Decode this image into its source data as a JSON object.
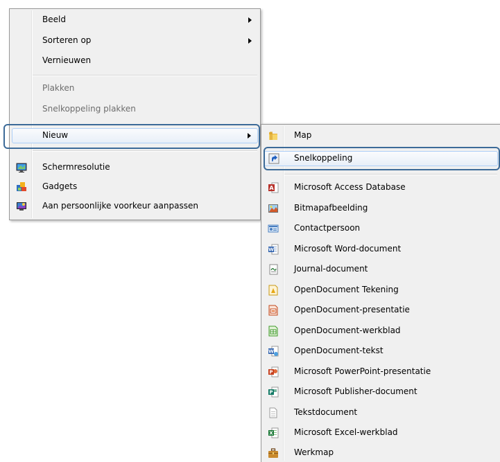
{
  "context_menu": {
    "items": [
      {
        "label": "Beeld",
        "has_submenu": true
      },
      {
        "label": "Sorteren op",
        "has_submenu": true
      },
      {
        "label": "Vernieuwen"
      },
      {
        "label": "Plakken",
        "disabled": true
      },
      {
        "label": "Snelkoppeling plakken",
        "disabled": true
      },
      {
        "label": "Nieuw",
        "has_submenu": true,
        "highlighted": true
      },
      {
        "label": "Schermresolutie",
        "icon": "monitor-icon"
      },
      {
        "label": "Gadgets",
        "icon": "gadgets-icon"
      },
      {
        "label": "Aan persoonlijke voorkeur aanpassen",
        "icon": "personalize-icon"
      }
    ]
  },
  "submenu": {
    "items": [
      {
        "label": "Map",
        "icon": "folder-icon"
      },
      {
        "label": "Snelkoppeling",
        "icon": "shortcut-icon",
        "highlighted": true
      },
      {
        "label": "Microsoft Access Database",
        "icon": "access-icon"
      },
      {
        "label": "Bitmapafbeelding",
        "icon": "bitmap-icon"
      },
      {
        "label": "Contactpersoon",
        "icon": "contact-icon"
      },
      {
        "label": "Microsoft Word-document",
        "icon": "word-icon"
      },
      {
        "label": "Journal-document",
        "icon": "journal-icon"
      },
      {
        "label": "OpenDocument Tekening",
        "icon": "odg-icon"
      },
      {
        "label": "OpenDocument-presentatie",
        "icon": "odp-icon"
      },
      {
        "label": "OpenDocument-werkblad",
        "icon": "ods-icon"
      },
      {
        "label": "OpenDocument-tekst",
        "icon": "odt-icon"
      },
      {
        "label": "Microsoft PowerPoint-presentatie",
        "icon": "powerpoint-icon"
      },
      {
        "label": "Microsoft Publisher-document",
        "icon": "publisher-icon"
      },
      {
        "label": "Tekstdocument",
        "icon": "text-document-icon"
      },
      {
        "label": "Microsoft Excel-werkblad",
        "icon": "excel-icon"
      },
      {
        "label": "Werkmap",
        "icon": "briefcase-icon"
      }
    ]
  },
  "colors": {
    "menu_bg": "#f0f0f0",
    "highlight_border": "#aecff7",
    "callout_border": "#3c6a98",
    "disabled_text": "#6d6d6d"
  }
}
